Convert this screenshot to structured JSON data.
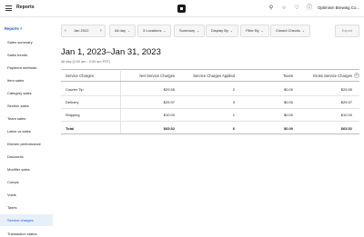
{
  "topbar": {
    "title": "Reports",
    "account": "Optimism Brewing Co...",
    "icons": [
      "menu-icon",
      "search-icon",
      "chat-icon",
      "bell-icon",
      "help-icon"
    ]
  },
  "sidebar": {
    "header": "Reports ˄",
    "items": [
      {
        "label": "Sales summary"
      },
      {
        "label": "Sales trends"
      },
      {
        "label": "Payment methods"
      },
      {
        "label": "Item sales"
      },
      {
        "label": "Category sales"
      },
      {
        "label": "Section sales"
      },
      {
        "label": "Team sales"
      },
      {
        "label": "Labor vs sales"
      },
      {
        "label": "Kitchen performance"
      },
      {
        "label": "Discounts"
      },
      {
        "label": "Modifier sales"
      },
      {
        "label": "Comps"
      },
      {
        "label": "Voids"
      },
      {
        "label": "Taxes"
      },
      {
        "label": "Service charges",
        "active": true
      },
      {
        "label": "Transaction status"
      }
    ]
  },
  "toolbar": {
    "date": "Jan 2022",
    "all_day": "All day",
    "locations": "3 Locations",
    "summary": "Summary",
    "display_by": "Display By",
    "filter_by": "Filter By",
    "closed_checks": "Closed Checks",
    "export": "Export",
    "accent": "#1a5bd6"
  },
  "report": {
    "title": "Jan 1, 2023–Jan 31, 2023",
    "subtitle": "All day (2:00 am - 2:00 am PST)"
  },
  "table": {
    "headers": [
      "Service Charges",
      "Net Service Charges",
      "Service Charges Applied",
      "Taxes",
      "Gross Service Charges"
    ],
    "rows": [
      [
        "Courier Tip",
        "$29.55",
        "2",
        "$0.00",
        "$29.55"
      ],
      [
        "Delivery",
        "$25.97",
        "3",
        "$0.00",
        "$25.97"
      ],
      [
        "Shipping",
        "$10.00",
        "1",
        "$0.00",
        "$10.00"
      ]
    ],
    "total": [
      "Total",
      "$65.52",
      "6",
      "$0.00",
      "$65.52"
    ]
  }
}
